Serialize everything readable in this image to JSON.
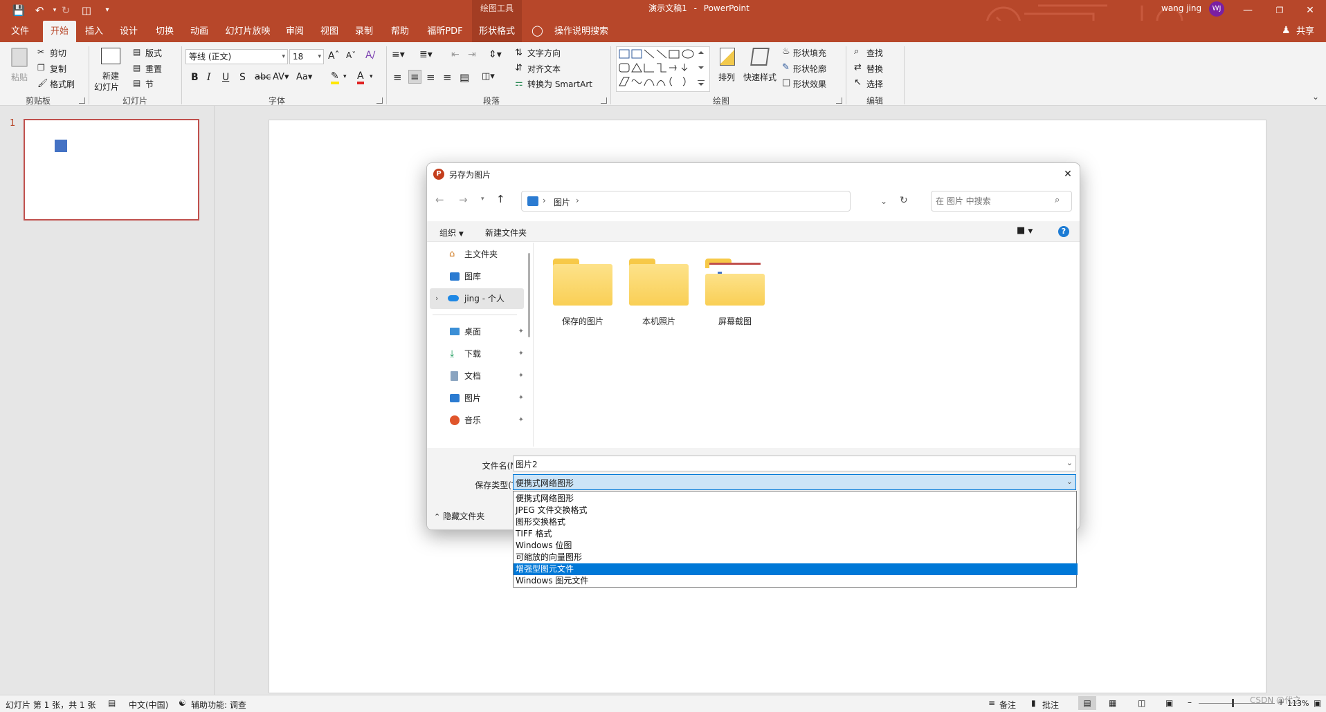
{
  "app": {
    "doc_title": "演示文稿1",
    "separator": "-",
    "app_name": "PowerPoint",
    "context_tab_group": "绘图工具",
    "user_name": "wang jing",
    "user_initials": "WJ",
    "share_label": "共享",
    "accent": "#b7472a"
  },
  "tabs": [
    "文件",
    "开始",
    "插入",
    "设计",
    "切换",
    "动画",
    "幻灯片放映",
    "审阅",
    "视图",
    "录制",
    "帮助",
    "福昕PDF",
    "形状格式"
  ],
  "tell_me": "操作说明搜索",
  "ribbon": {
    "clipboard": {
      "paste": "粘贴",
      "cut": "剪切",
      "copy": "复制",
      "format_painter": "格式刷",
      "group": "剪贴板"
    },
    "slides": {
      "new_slide_1": "新建",
      "new_slide_2": "幻灯片",
      "layout": "版式",
      "reset": "重置",
      "section": "节",
      "group": "幻灯片"
    },
    "font": {
      "name": "等线 (正文)",
      "size": "18",
      "group": "字体"
    },
    "paragraph": {
      "text_direction": "文字方向",
      "align_text": "对齐文本",
      "smartart": "转换为 SmartArt",
      "group": "段落"
    },
    "drawing": {
      "arrange": "排列",
      "quick_styles": "快速样式",
      "shape_fill": "形状填充",
      "shape_outline": "形状轮廓",
      "shape_effects": "形状效果",
      "group": "绘图"
    },
    "editing": {
      "find": "查找",
      "replace": "替换",
      "select": "选择",
      "group": "编辑"
    }
  },
  "thumbnail": {
    "number": "1"
  },
  "dialog": {
    "title": "另存为图片",
    "breadcrumb": [
      "图片"
    ],
    "search_placeholder": "在 图片 中搜索",
    "organize": "组织",
    "new_folder": "新建文件夹",
    "nav_items": [
      {
        "label": "主文件夹",
        "icon": "home-icon",
        "pinned": false
      },
      {
        "label": "图库",
        "icon": "gallery-icon",
        "pinned": false
      },
      {
        "label": "jing - 个人",
        "icon": "cloud-icon",
        "pinned": false
      },
      {
        "label": "桌面",
        "icon": "desktop-icon",
        "pinned": true
      },
      {
        "label": "下载",
        "icon": "download-icon",
        "pinned": true
      },
      {
        "label": "文档",
        "icon": "document-icon",
        "pinned": true
      },
      {
        "label": "图片",
        "icon": "pictures-icon",
        "pinned": true
      },
      {
        "label": "音乐",
        "icon": "music-icon",
        "pinned": true
      }
    ],
    "folders": [
      "保存的图片",
      "本机照片",
      "屏幕截图"
    ],
    "filename_label": "文件名(N):",
    "filename_value": "图片2",
    "savetype_label": "保存类型(T):",
    "savetype_value": "便携式网络图形",
    "hide_folders": "隐藏文件夹",
    "type_options": [
      "便携式网络图形",
      "JPEG 文件交换格式",
      "图形交换格式",
      "TIFF 格式",
      "Windows 位图",
      "可缩放的向量图形",
      "增强型图元文件",
      "Windows 图元文件"
    ],
    "selected_option_index": 6
  },
  "status": {
    "slide_info": "幻灯片 第 1 张，共 1 张",
    "language": "中文(中国)",
    "accessibility": "辅助功能: 调查",
    "notes": "备注",
    "comments": "批注",
    "zoom": "113%",
    "watermark": "CSDN @代之"
  }
}
